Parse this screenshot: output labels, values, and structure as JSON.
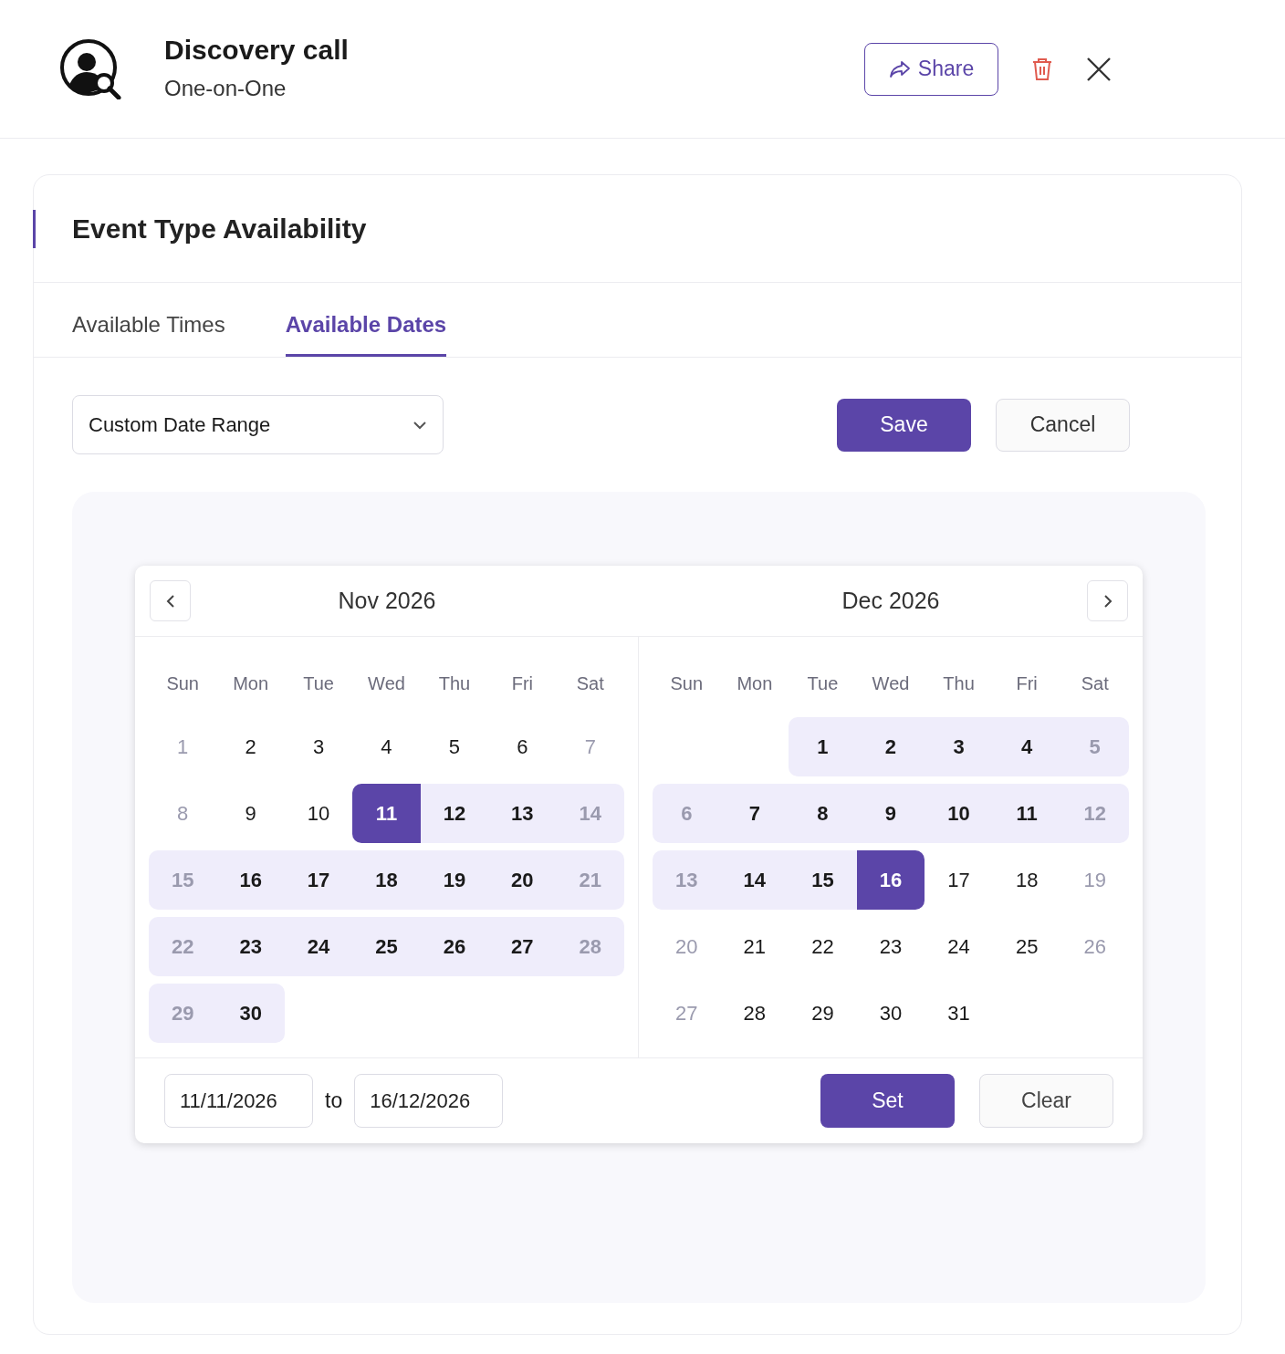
{
  "header": {
    "title": "Discovery call",
    "subtitle": "One-on-One",
    "share_label": "Share"
  },
  "card": {
    "title": "Event Type Availability"
  },
  "tabs": [
    {
      "label": "Available Times",
      "selected": false
    },
    {
      "label": "Available Dates",
      "selected": true
    }
  ],
  "range_select": {
    "value": "Custom Date Range"
  },
  "actions": {
    "save": "Save",
    "cancel": "Cancel"
  },
  "calendar": {
    "months": [
      {
        "title": "Nov 2026",
        "weekdays": [
          "Sun",
          "Mon",
          "Tue",
          "Wed",
          "Thu",
          "Fri",
          "Sat"
        ],
        "weeks": [
          [
            {
              "kind": "day",
              "day": "1",
              "in_range": false,
              "endpoint": false,
              "muted": true
            },
            {
              "kind": "day",
              "day": "2",
              "in_range": false,
              "endpoint": false,
              "muted": false
            },
            {
              "kind": "day",
              "day": "3",
              "in_range": false,
              "endpoint": false,
              "muted": false
            },
            {
              "kind": "day",
              "day": "4",
              "in_range": false,
              "endpoint": false,
              "muted": false
            },
            {
              "kind": "day",
              "day": "5",
              "in_range": false,
              "endpoint": false,
              "muted": false
            },
            {
              "kind": "day",
              "day": "6",
              "in_range": false,
              "endpoint": false,
              "muted": false
            },
            {
              "kind": "day",
              "day": "7",
              "in_range": false,
              "endpoint": false,
              "muted": true
            }
          ],
          [
            {
              "kind": "day",
              "day": "8",
              "in_range": false,
              "endpoint": false,
              "muted": true
            },
            {
              "kind": "day",
              "day": "9",
              "in_range": false,
              "endpoint": false,
              "muted": false
            },
            {
              "kind": "day",
              "day": "10",
              "in_range": false,
              "endpoint": false,
              "muted": false
            },
            {
              "kind": "day",
              "day": "11",
              "in_range": true,
              "endpoint": true,
              "muted": false
            },
            {
              "kind": "day",
              "day": "12",
              "in_range": true,
              "endpoint": false,
              "muted": false
            },
            {
              "kind": "day",
              "day": "13",
              "in_range": true,
              "endpoint": false,
              "muted": false
            },
            {
              "kind": "day",
              "day": "14",
              "in_range": true,
              "endpoint": false,
              "muted": true
            }
          ],
          [
            {
              "kind": "day",
              "day": "15",
              "in_range": true,
              "endpoint": false,
              "muted": true
            },
            {
              "kind": "day",
              "day": "16",
              "in_range": true,
              "endpoint": false,
              "muted": false
            },
            {
              "kind": "day",
              "day": "17",
              "in_range": true,
              "endpoint": false,
              "muted": false
            },
            {
              "kind": "day",
              "day": "18",
              "in_range": true,
              "endpoint": false,
              "muted": false
            },
            {
              "kind": "day",
              "day": "19",
              "in_range": true,
              "endpoint": false,
              "muted": false
            },
            {
              "kind": "day",
              "day": "20",
              "in_range": true,
              "endpoint": false,
              "muted": false
            },
            {
              "kind": "day",
              "day": "21",
              "in_range": true,
              "endpoint": false,
              "muted": true
            }
          ],
          [
            {
              "kind": "day",
              "day": "22",
              "in_range": true,
              "endpoint": false,
              "muted": true
            },
            {
              "kind": "day",
              "day": "23",
              "in_range": true,
              "endpoint": false,
              "muted": false
            },
            {
              "kind": "day",
              "day": "24",
              "in_range": true,
              "endpoint": false,
              "muted": false
            },
            {
              "kind": "day",
              "day": "25",
              "in_range": true,
              "endpoint": false,
              "muted": false
            },
            {
              "kind": "day",
              "day": "26",
              "in_range": true,
              "endpoint": false,
              "muted": false
            },
            {
              "kind": "day",
              "day": "27",
              "in_range": true,
              "endpoint": false,
              "muted": false
            },
            {
              "kind": "day",
              "day": "28",
              "in_range": true,
              "endpoint": false,
              "muted": true
            }
          ],
          [
            {
              "kind": "day",
              "day": "29",
              "in_range": true,
              "endpoint": false,
              "muted": true
            },
            {
              "kind": "day",
              "day": "30",
              "in_range": true,
              "endpoint": false,
              "muted": false
            }
          ]
        ]
      },
      {
        "title": "Dec 2026",
        "weekdays": [
          "Sun",
          "Mon",
          "Tue",
          "Wed",
          "Thu",
          "Fri",
          "Sat"
        ],
        "weeks": [
          [
            {
              "kind": "blank"
            },
            {
              "kind": "blank"
            },
            {
              "kind": "day",
              "day": "1",
              "in_range": true,
              "endpoint": false,
              "muted": false
            },
            {
              "kind": "day",
              "day": "2",
              "in_range": true,
              "endpoint": false,
              "muted": false
            },
            {
              "kind": "day",
              "day": "3",
              "in_range": true,
              "endpoint": false,
              "muted": false
            },
            {
              "kind": "day",
              "day": "4",
              "in_range": true,
              "endpoint": false,
              "muted": false
            },
            {
              "kind": "day",
              "day": "5",
              "in_range": true,
              "endpoint": false,
              "muted": true
            }
          ],
          [
            {
              "kind": "day",
              "day": "6",
              "in_range": true,
              "endpoint": false,
              "muted": true
            },
            {
              "kind": "day",
              "day": "7",
              "in_range": true,
              "endpoint": false,
              "muted": false
            },
            {
              "kind": "day",
              "day": "8",
              "in_range": true,
              "endpoint": false,
              "muted": false
            },
            {
              "kind": "day",
              "day": "9",
              "in_range": true,
              "endpoint": false,
              "muted": false
            },
            {
              "kind": "day",
              "day": "10",
              "in_range": true,
              "endpoint": false,
              "muted": false
            },
            {
              "kind": "day",
              "day": "11",
              "in_range": true,
              "endpoint": false,
              "muted": false
            },
            {
              "kind": "day",
              "day": "12",
              "in_range": true,
              "endpoint": false,
              "muted": true
            }
          ],
          [
            {
              "kind": "day",
              "day": "13",
              "in_range": true,
              "endpoint": false,
              "muted": true
            },
            {
              "kind": "day",
              "day": "14",
              "in_range": true,
              "endpoint": false,
              "muted": false
            },
            {
              "kind": "day",
              "day": "15",
              "in_range": true,
              "endpoint": false,
              "muted": false
            },
            {
              "kind": "day",
              "day": "16",
              "in_range": true,
              "endpoint": true,
              "muted": false
            },
            {
              "kind": "day",
              "day": "17",
              "in_range": false,
              "endpoint": false,
              "muted": false
            },
            {
              "kind": "day",
              "day": "18",
              "in_range": false,
              "endpoint": false,
              "muted": false
            },
            {
              "kind": "day",
              "day": "19",
              "in_range": false,
              "endpoint": false,
              "muted": true
            }
          ],
          [
            {
              "kind": "day",
              "day": "20",
              "in_range": false,
              "endpoint": false,
              "muted": true
            },
            {
              "kind": "day",
              "day": "21",
              "in_range": false,
              "endpoint": false,
              "muted": false
            },
            {
              "kind": "day",
              "day": "22",
              "in_range": false,
              "endpoint": false,
              "muted": false
            },
            {
              "kind": "day",
              "day": "23",
              "in_range": false,
              "endpoint": false,
              "muted": false
            },
            {
              "kind": "day",
              "day": "24",
              "in_range": false,
              "endpoint": false,
              "muted": false
            },
            {
              "kind": "day",
              "day": "25",
              "in_range": false,
              "endpoint": false,
              "muted": false
            },
            {
              "kind": "day",
              "day": "26",
              "in_range": false,
              "endpoint": false,
              "muted": true
            }
          ],
          [
            {
              "kind": "day",
              "day": "27",
              "in_range": false,
              "endpoint": false,
              "muted": true
            },
            {
              "kind": "day",
              "day": "28",
              "in_range": false,
              "endpoint": false,
              "muted": false
            },
            {
              "kind": "day",
              "day": "29",
              "in_range": false,
              "endpoint": false,
              "muted": false
            },
            {
              "kind": "day",
              "day": "30",
              "in_range": false,
              "endpoint": false,
              "muted": false
            },
            {
              "kind": "day",
              "day": "31",
              "in_range": false,
              "endpoint": false,
              "muted": false
            }
          ]
        ]
      }
    ],
    "from": "11/11/2026",
    "to_label": "to",
    "to": "16/12/2026",
    "set": "Set",
    "clear": "Clear"
  }
}
